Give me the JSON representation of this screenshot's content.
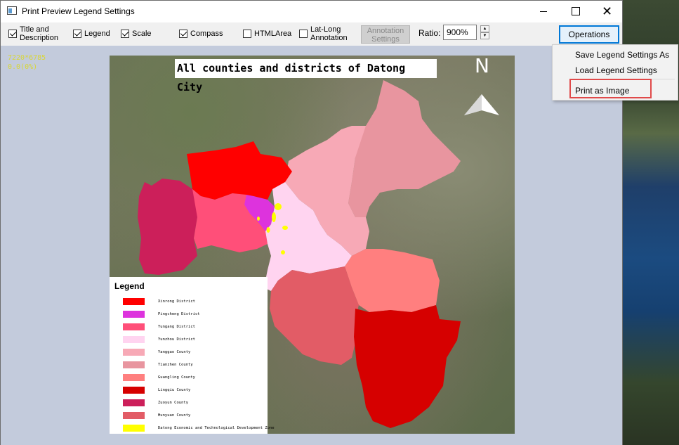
{
  "window": {
    "title": "Print Preview Legend Settings"
  },
  "toolbar": {
    "checkboxes": [
      {
        "label": "Title and Description",
        "checked": true
      },
      {
        "label": "Legend",
        "checked": true
      },
      {
        "label": "Scale",
        "checked": true
      },
      {
        "label": "Compass",
        "checked": true
      },
      {
        "label": "HTMLArea",
        "checked": false
      },
      {
        "label": "Lat-Long Annotation",
        "checked": false
      }
    ],
    "annotation_settings_label": "Annotation Settings",
    "ratio_label": "Ratio:",
    "ratio_value": "900%",
    "operations_label": "Operations"
  },
  "preview": {
    "scale_info": [
      "7220*6785",
      "0.0(0%)"
    ],
    "map_title": "All counties and districts of Datong City",
    "compass_label": "N"
  },
  "legend": {
    "title": "Legend",
    "items": [
      {
        "label": "Xinrong District",
        "color": "#ff0000"
      },
      {
        "label": "Pingcheng District",
        "color": "#dd33dd"
      },
      {
        "label": "Yungang District",
        "color": "#ff4f79"
      },
      {
        "label": "Yunzhou District",
        "color": "#ffd4f0"
      },
      {
        "label": "Yanggao County",
        "color": "#f7a9b6"
      },
      {
        "label": "Tianzhen County",
        "color": "#e8959f"
      },
      {
        "label": "Guangling County",
        "color": "#ff7f7f"
      },
      {
        "label": "Lingqiu County",
        "color": "#d60000"
      },
      {
        "label": "Zuoyun County",
        "color": "#cc1f5a"
      },
      {
        "label": "Hunyuan County",
        "color": "#e25c66"
      },
      {
        "label": "Datong Economic and Technological Development Zone",
        "color": "#ffff00"
      }
    ]
  },
  "operations_menu": {
    "items": [
      "Save Legend Settings As",
      "Load Legend Settings",
      "Print as Image"
    ],
    "highlighted": "Print as Image"
  }
}
